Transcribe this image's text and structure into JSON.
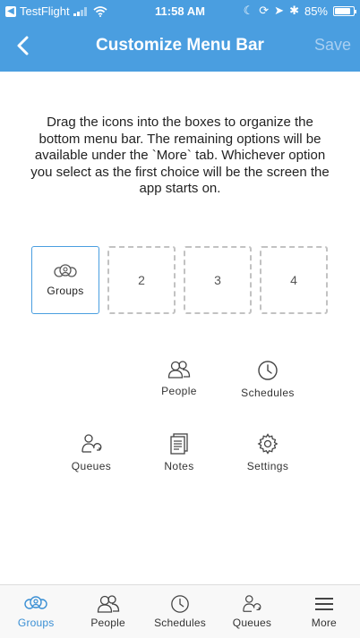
{
  "status": {
    "back_app": "TestFlight",
    "time": "11:58 AM",
    "battery": "85%",
    "battery_level": 0.85
  },
  "nav": {
    "title": "Customize Menu Bar",
    "save": "Save"
  },
  "instructions": "Drag the icons into the boxes to organize the bottom menu bar. The remaining options will be available under the `More` tab. Whichever option you select as the first choice will be the screen the app starts on.",
  "slots": {
    "first": "Groups",
    "second": "2",
    "third": "3",
    "fourth": "4"
  },
  "options": {
    "people": "People",
    "schedules": "Schedules",
    "queues": "Queues",
    "notes": "Notes",
    "settings": "Settings"
  },
  "tabs": {
    "groups": "Groups",
    "people": "People",
    "schedules": "Schedules",
    "queues": "Queues",
    "more": "More"
  },
  "colors": {
    "accent": "#4a9ee0",
    "active_tab": "#3a8fd4"
  }
}
